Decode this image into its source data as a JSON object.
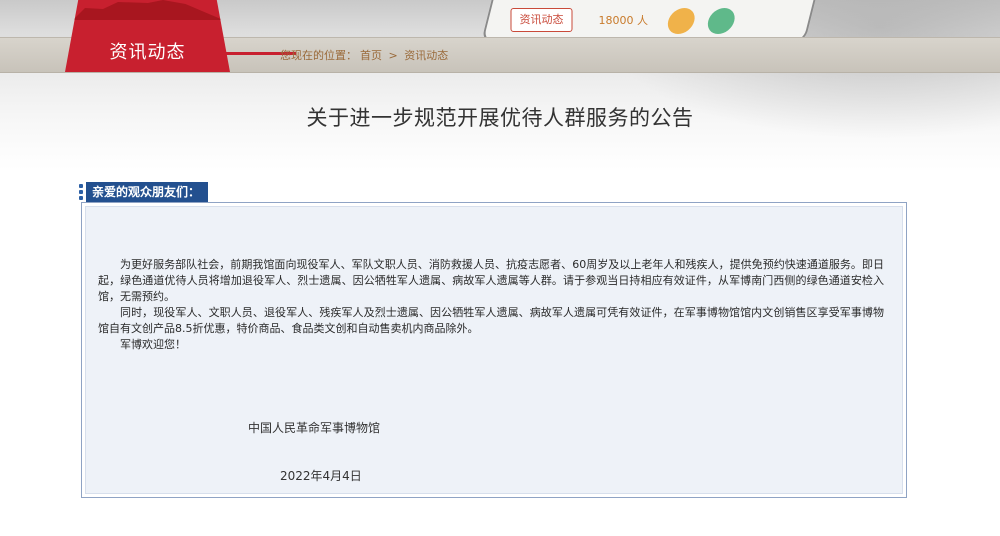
{
  "header": {
    "section_title": "资讯动态",
    "breadcrumb": {
      "prefix": "您现在的位置：",
      "home": "首页",
      "separator": ">",
      "current": "资讯动态"
    },
    "phone_tab_label": "资讯动态",
    "phone_count": "18000 人"
  },
  "article": {
    "title": "关于进一步规范开展优待人群服务的公告",
    "salutation": "亲爱的观众朋友们：",
    "paragraphs": [
      "为更好服务部队社会，前期我馆面向现役军人、军队文职人员、消防救援人员、抗疫志愿者、60周岁及以上老年人和残疾人，提供免预约快速通道服务。即日起，绿色通道优待人员将增加退役军人、烈士遗属、因公牺牲军人遗属、病故军人遗属等人群。请于参观当日持相应有效证件，从军博南门西侧的绿色通道安检入馆，无需预约。",
      "同时，现役军人、文职人员、退役军人、残疾军人及烈士遗属、因公牺牲军人遗属、病故军人遗属可凭有效证件，在军事博物馆馆内文创销售区享受军事博物馆自有文创产品8.5折优惠，特价商品、食品类文创和自动售卖机内商品除外。",
      "军博欢迎您！"
    ],
    "signature": "中国人民革命军事博物馆",
    "date": "2022年4月4日"
  },
  "colors": {
    "accent_red": "#c8202f",
    "salutation_blue": "#23508f",
    "box_bg": "#eef2f8"
  }
}
